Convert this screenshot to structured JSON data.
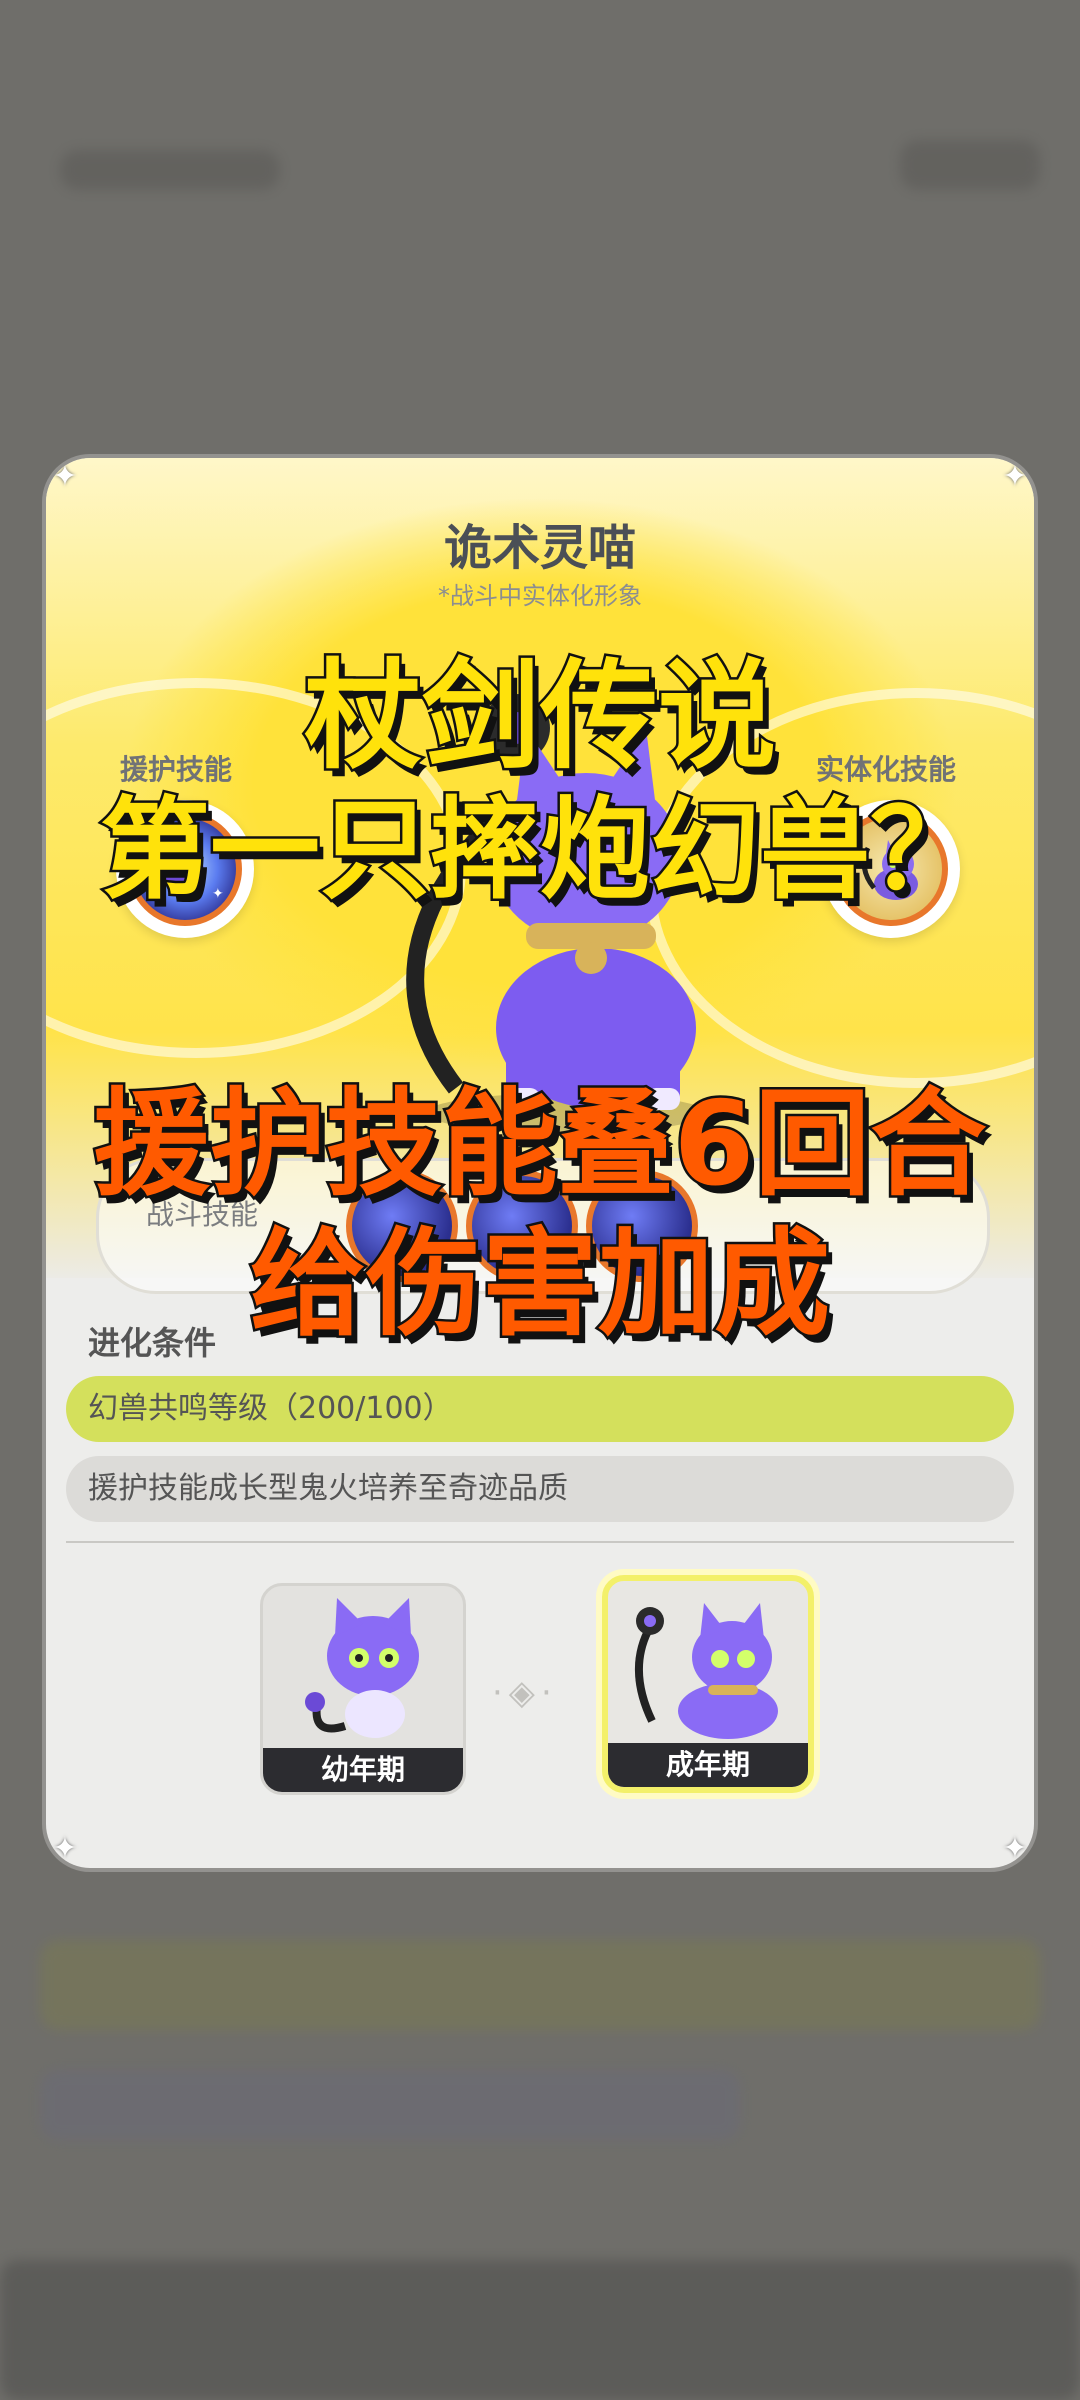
{
  "beast": {
    "name": "诡术灵喵",
    "subtitle": "*战斗中实体化形象"
  },
  "skills": {
    "support_label": "援护技能",
    "manifest_label": "实体化技能",
    "battle_label": "战斗技能"
  },
  "evolution": {
    "section_title": "进化条件",
    "conditions": [
      {
        "text": "幻兽共鸣等级（200/100）",
        "status": "completed"
      },
      {
        "text": "援护技能成长型鬼火培养至奇迹品质",
        "status": "incomplete"
      }
    ],
    "stages": [
      {
        "label": "幼年期",
        "selected": false
      },
      {
        "label": "成年期",
        "selected": true
      }
    ]
  },
  "overlay": {
    "line1": "杖剑传说",
    "line2": "第一只摔炮幻兽？",
    "line3": "援护技能叠6回合",
    "line4": "给伤害加成"
  },
  "colors": {
    "accent_yellow": "#ffe20b",
    "accent_orange": "#ff5a00",
    "completed_bar": "#d4e05c",
    "skill_ring": "#e8772b"
  }
}
